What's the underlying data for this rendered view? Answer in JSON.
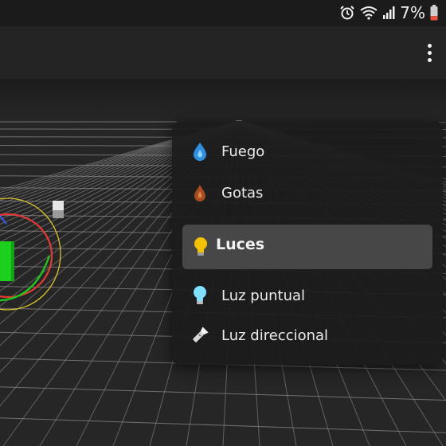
{
  "status_bar": {
    "battery_percent": "7%",
    "icons": [
      "alarm-icon",
      "wifi-icon",
      "signal-icon",
      "battery-low-icon"
    ],
    "battery_color": "#e5503c"
  },
  "toolbar": {
    "overflow_icon": "more-vert-icon"
  },
  "menu": {
    "items": [
      {
        "label": "Fuego",
        "icon": "fire-drop-icon",
        "color": "#2f8fe0"
      },
      {
        "label": "Gotas",
        "icon": "drop-icon",
        "color": "#b85a2a"
      }
    ],
    "section": {
      "label": "Luces",
      "icon": "light-bulb-icon",
      "color": "#f2c300"
    },
    "section_items": [
      {
        "label": "Luz puntual",
        "icon": "point-light-bulb-icon",
        "color": "#7fe0ff"
      },
      {
        "label": "Luz direccional",
        "icon": "flashlight-icon",
        "color": "#d8d8d8"
      }
    ]
  },
  "viewport": {
    "grid_color": "#8a8a8a",
    "cube_color": "#1ed01e",
    "gizmo_colors": [
      "#e53935",
      "#1ec81e",
      "#d9c22a",
      "#3a5cff"
    ]
  }
}
